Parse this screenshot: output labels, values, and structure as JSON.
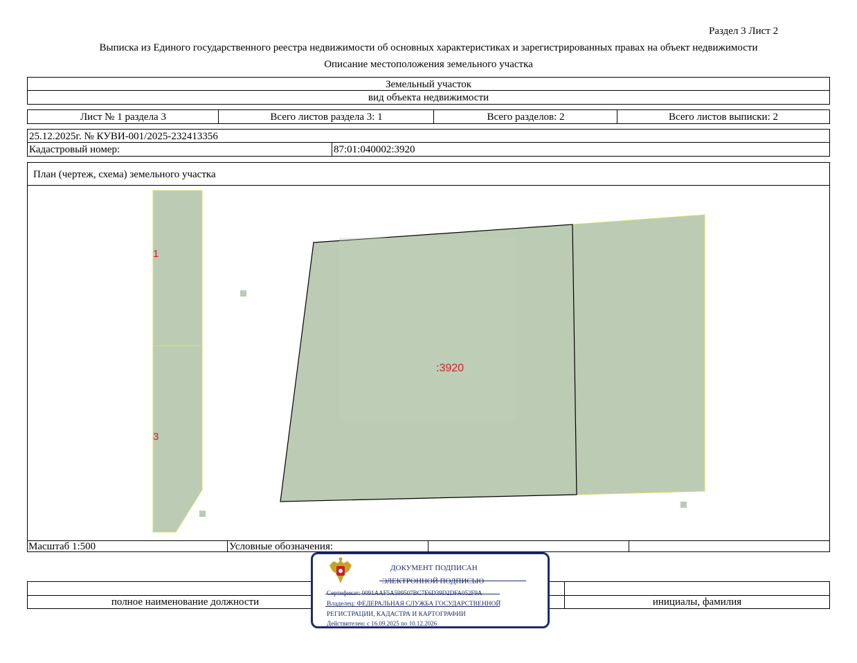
{
  "header": {
    "section_sheet": "Раздел 3    Лист 2",
    "title": "Выписка из Единого государственного реестра недвижимости об основных характеристиках и зарегистрированных правах на объект недвижимости",
    "subtitle": "Описание местоположения земельного участка"
  },
  "object": {
    "type_value": "Земельный участок",
    "type_label": "вид объекта недвижимости"
  },
  "sheets": {
    "sheet": "Лист № 1 раздела 3",
    "total_section_sheets": "Всего листов раздела 3: 1",
    "total_sections": "Всего разделов: 2",
    "total_extract_sheets": "Всего листов выписки: 2"
  },
  "record": {
    "date_number": "25.12.2025г. № КУВИ-001/2025-232413356",
    "cadastral_label": "Кадастровый номер:",
    "cadastral_value": "87:01:040002:3920"
  },
  "plan": {
    "title": "План (чертеж, схема) земельного участка",
    "parcel_label": ":3920",
    "neighbor_label_1": "1",
    "neighbor_label_2": "3",
    "colors": {
      "parcel_fill": "#bccbb4",
      "parcel_edge": "#d4e06a",
      "label_red": "#d0202a",
      "outline": "#000000"
    }
  },
  "footer": {
    "scale": "Масштаб 1:500",
    "legend_label": "Условные обозначения:",
    "position_caption": "полное наименование должности",
    "name_caption": "инициалы, фамилия"
  },
  "stamp": {
    "emblem_icon": "coat-of-arms-icon",
    "line1": "ДОКУМЕНТ ПОДПИСАН",
    "line2": "ЭЛЕКТРОННОЙ ПОДПИСЬЮ",
    "certificate": "Сертификат: 0091AAF5A599507BC7E6D39D2DFA052F9A",
    "owner_1": "Владелец: ФЕДЕРАЛЬНАЯ СЛУЖБА ГОСУДАРСТВЕННОЙ",
    "owner_2": "РЕГИСТРАЦИИ, КАДАСТРА И КАРТОГРАФИИ",
    "valid": "Действителен: с 16.09.2025 по 10.12.2026",
    "color": "#1c2a6e"
  }
}
